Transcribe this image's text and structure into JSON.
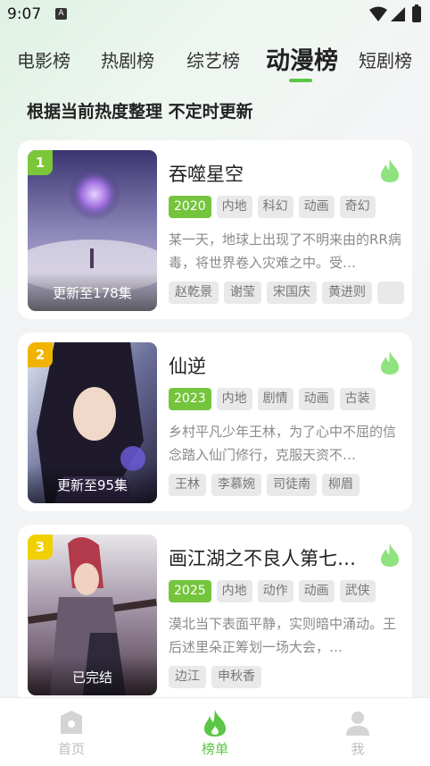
{
  "status_bar": {
    "time": "9:07",
    "notif_glyph": "A"
  },
  "tabs": [
    {
      "label": "电影榜",
      "active": false
    },
    {
      "label": "热剧榜",
      "active": false
    },
    {
      "label": "综艺榜",
      "active": false
    },
    {
      "label": "动漫榜",
      "active": true
    },
    {
      "label": "短剧榜",
      "active": false
    }
  ],
  "subtitle": "根据当前热度整理 不定时更新",
  "colors": {
    "accent": "#5cc646",
    "year_tag": "#75c43e",
    "rank1": "#7cc63a",
    "rank2": "#f0b400",
    "rank3": "#f0b400"
  },
  "items": [
    {
      "rank": "1",
      "update": "更新至178集",
      "title": "吞噬星空",
      "year": "2020",
      "tags": [
        "内地",
        "科幻",
        "动画",
        "奇幻"
      ],
      "desc": "某一天，地球上出现了不明来由的RR病毒，将世界卷入灾难之中。受…",
      "cast": [
        "赵乾景",
        "谢莹",
        "宋国庆",
        "黄进则",
        ""
      ]
    },
    {
      "rank": "2",
      "update": "更新至95集",
      "title": "仙逆",
      "year": "2023",
      "tags": [
        "内地",
        "剧情",
        "动画",
        "古装"
      ],
      "desc": "乡村平凡少年王林，为了心中不屈的信念踏入仙门修行，克服天资不…",
      "cast": [
        "王林",
        "李慕婉",
        "司徒南",
        "柳眉"
      ]
    },
    {
      "rank": "3",
      "update": "已完结",
      "title": "画江湖之不良人第七…",
      "year": "2025",
      "tags": [
        "内地",
        "动作",
        "动画",
        "武侠"
      ],
      "desc": "漠北当下表面平静，实则暗中涌动。王后述里朵正筹划一场大会，…",
      "cast": [
        "边江",
        "申秋香"
      ]
    }
  ],
  "bottom_nav": [
    {
      "label": "首页",
      "icon": "home-icon",
      "active": false
    },
    {
      "label": "榜单",
      "icon": "flame-icon",
      "active": true
    },
    {
      "label": "我",
      "icon": "user-icon",
      "active": false
    }
  ]
}
